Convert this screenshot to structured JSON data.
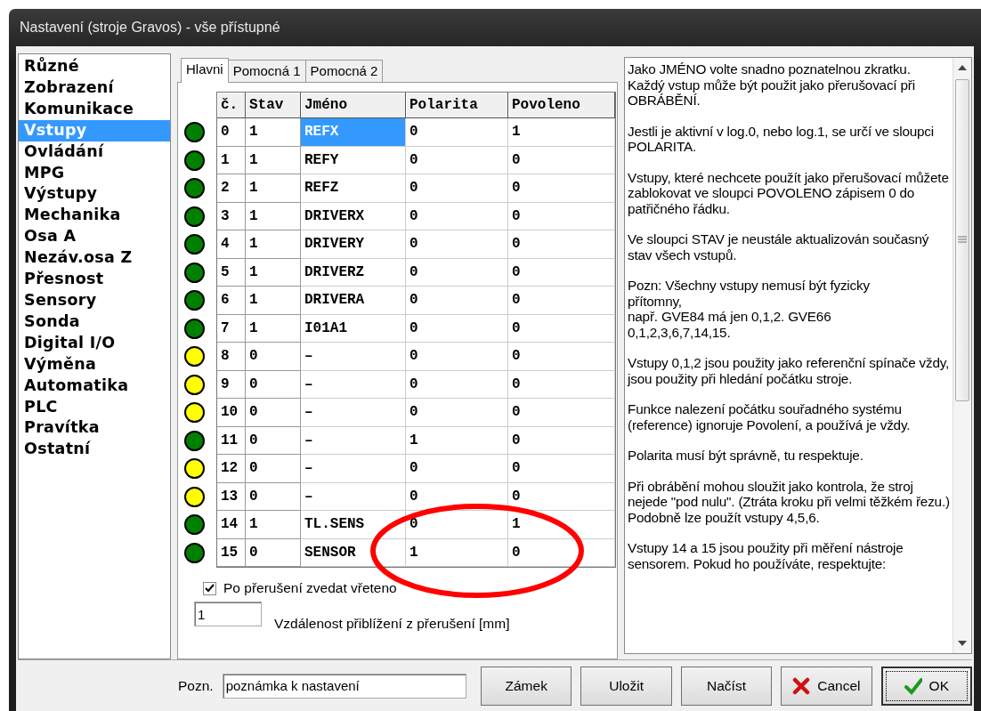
{
  "window": {
    "title": "Nastavení (stroje Gravos) - vše přístupné"
  },
  "sidebar": {
    "items": [
      {
        "label": "Různé",
        "selected": false
      },
      {
        "label": "Zobrazení",
        "selected": false
      },
      {
        "label": "Komunikace",
        "selected": false
      },
      {
        "label": "Vstupy",
        "selected": true
      },
      {
        "label": "Ovládání",
        "selected": false
      },
      {
        "label": "MPG",
        "selected": false
      },
      {
        "label": "Výstupy",
        "selected": false
      },
      {
        "label": "Mechanika",
        "selected": false
      },
      {
        "label": "Osa A",
        "selected": false
      },
      {
        "label": "Nezáv.osa Z",
        "selected": false
      },
      {
        "label": "Přesnost",
        "selected": false
      },
      {
        "label": "Sensory",
        "selected": false
      },
      {
        "label": "Sonda",
        "selected": false
      },
      {
        "label": "Digital I/O",
        "selected": false
      },
      {
        "label": "Výměna",
        "selected": false
      },
      {
        "label": "Automatika",
        "selected": false
      },
      {
        "label": "PLC",
        "selected": false
      },
      {
        "label": "Pravítka",
        "selected": false
      },
      {
        "label": "Ostatní",
        "selected": false
      }
    ]
  },
  "tabs": [
    {
      "label": "Hlavni",
      "selected": true
    },
    {
      "label": "Pomocná 1",
      "selected": false
    },
    {
      "label": "Pomocná 2",
      "selected": false
    }
  ],
  "table": {
    "columns": [
      "č.",
      "Stav",
      "Jméno",
      "Polarita",
      "Povoleno"
    ],
    "rows": [
      {
        "color": "#008000",
        "cells": [
          "0",
          "1",
          "REFX",
          "0",
          "1"
        ],
        "selected": true
      },
      {
        "color": "#008000",
        "cells": [
          "1",
          "1",
          "REFY",
          "0",
          "0"
        ],
        "selected": false
      },
      {
        "color": "#008000",
        "cells": [
          "2",
          "1",
          "REFZ",
          "0",
          "0"
        ],
        "selected": false
      },
      {
        "color": "#008000",
        "cells": [
          "3",
          "1",
          "DRIVERX",
          "0",
          "0"
        ],
        "selected": false
      },
      {
        "color": "#008000",
        "cells": [
          "4",
          "1",
          "DRIVERY",
          "0",
          "0"
        ],
        "selected": false
      },
      {
        "color": "#008000",
        "cells": [
          "5",
          "1",
          "DRIVERZ",
          "0",
          "0"
        ],
        "selected": false
      },
      {
        "color": "#008000",
        "cells": [
          "6",
          "1",
          "DRIVERA",
          "0",
          "0"
        ],
        "selected": false
      },
      {
        "color": "#008000",
        "cells": [
          "7",
          "1",
          "I01A1",
          "0",
          "0"
        ],
        "selected": false
      },
      {
        "color": "#ffff00",
        "cells": [
          "8",
          "0",
          "–",
          "0",
          "0"
        ],
        "selected": false
      },
      {
        "color": "#ffff00",
        "cells": [
          "9",
          "0",
          "–",
          "0",
          "0"
        ],
        "selected": false
      },
      {
        "color": "#ffff00",
        "cells": [
          "10",
          "0",
          "–",
          "0",
          "0"
        ],
        "selected": false
      },
      {
        "color": "#008000",
        "cells": [
          "11",
          "0",
          "–",
          "1",
          "0"
        ],
        "selected": false
      },
      {
        "color": "#ffff00",
        "cells": [
          "12",
          "0",
          "–",
          "0",
          "0"
        ],
        "selected": false
      },
      {
        "color": "#ffff00",
        "cells": [
          "13",
          "0",
          "–",
          "0",
          "0"
        ],
        "selected": false
      },
      {
        "color": "#008000",
        "cells": [
          "14",
          "1",
          "TL.SENS",
          "0",
          "1"
        ],
        "selected": false
      },
      {
        "color": "#008000",
        "cells": [
          "15",
          "0",
          "SENSOR",
          "1",
          "0"
        ],
        "selected": false
      }
    ]
  },
  "lift_spindle": {
    "label": "Po přerušení zvedat vřeteno",
    "checked": true
  },
  "approach_distance": {
    "value": "1",
    "label": "Vzdálenost přiblížení z přerušení [mm]"
  },
  "help_text": [
    "Jako JMÉNO volte snadno poznatelnou zkratku. Každý vstup může být použit jako přerušovací při OBRÁBĚNÍ.",
    "Jestli je aktivní v log.0, nebo log.1, se určí ve sloupci POLARITA.",
    "Vstupy, které nechcete použít jako přerušovací můžete zablokovat ve sloupci POVOLENO zápisem 0 do patřičného řádku.",
    "Ve sloupci STAV je neustále aktualizován současný stav všech vstupů.",
    "Pozn: Všechny vstupy nemusí být fyzicky\npřítomny,\nnapř. GVE84 má jen 0,1,2. GVE66\n0,1,2,3,6,7,14,15.",
    "Vstupy 0,1,2 jsou použity jako referenční spínače vždy, jsou použity při hledání počátku stroje.",
    "Funkce nalezení počátku souřadného systému (reference) ignoruje Povolení, a  používá je vždy.",
    "Polarita musí být správně, tu respektuje.",
    "Při obrábění mohou sloužit jako kontrola, že stroj nejede \"pod nulu\". (Ztráta kroku při velmi těžkém řezu.) Podobně lze použít vstupy 4,5,6.",
    "Vstupy 14 a 15 jsou použity při měření nástroje sensorem. Pokud ho používáte, respektujte:"
  ],
  "note": {
    "label": "Pozn.",
    "value": "poznámka k nastavení"
  },
  "buttons": [
    {
      "kind": "plain",
      "label": "Zámek"
    },
    {
      "kind": "plain",
      "label": "Uložit"
    },
    {
      "kind": "plain",
      "label": "Načíst"
    },
    {
      "kind": "cancel",
      "label": "Cancel"
    },
    {
      "kind": "ok",
      "label": "OK"
    }
  ]
}
